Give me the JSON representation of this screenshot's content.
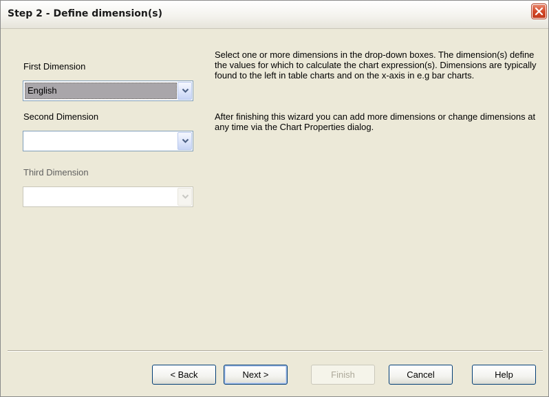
{
  "window": {
    "title": "Step 2 - Define dimension(s)",
    "close_icon": "close-icon"
  },
  "dimensions": {
    "first": {
      "label": "First Dimension",
      "value": "English"
    },
    "second": {
      "label": "Second Dimension",
      "value": ""
    },
    "third": {
      "label": "Third Dimension",
      "value": ""
    }
  },
  "description": {
    "paragraph1": "Select one or more dimensions in the drop-down boxes. The dimension(s) define the values for which to calculate the chart expression(s). Dimensions are typically found to the left in table charts and on the x-axis in e.g bar charts.",
    "paragraph2": "After finishing this wizard you can add more dimensions or change dimensions at any time via the Chart Properties dialog."
  },
  "buttons": {
    "back": "< Back",
    "next": "Next >",
    "finish": "Finish",
    "cancel": "Cancel",
    "help": "Help"
  },
  "colors": {
    "dialog_background": "#ece9d8",
    "close_button": "#d34a2a",
    "selected_value_highlight": "#a9a6aa",
    "button_border": "#003c74"
  }
}
